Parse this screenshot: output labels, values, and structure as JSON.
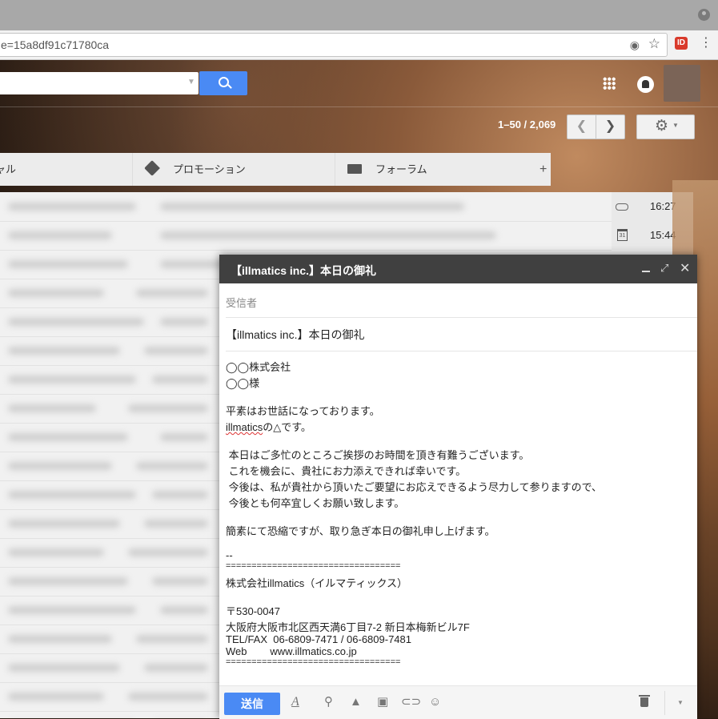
{
  "browser": {
    "url": "e=15a8df91c71780ca",
    "extension_label": "ID"
  },
  "gmail": {
    "page_count": "1–50 / 2,069",
    "tabs": [
      {
        "label": "ャル",
        "icon": "people-icon"
      },
      {
        "label": "プロモーション",
        "icon": "tag-icon"
      },
      {
        "label": "フォーラム",
        "icon": "forum-icon"
      }
    ],
    "tab_add": "+",
    "visible_rows": [
      {
        "icon": "paperclip-icon",
        "time": "16:27"
      },
      {
        "icon": "calendar-icon",
        "icon_text": "31",
        "time": "15:44"
      }
    ]
  },
  "compose": {
    "title": "【illmatics inc.】本日の御礼",
    "to_placeholder": "受信者",
    "subject": "【illmatics inc.】本日の御礼",
    "body": {
      "l1": "◯◯株式会社",
      "l2": "◯◯様",
      "l3": "平素はお世話になっております。",
      "l4a": "illmatics",
      "l4b": "の△です。",
      "l5": " 本日はご多忙のところご挨拶のお時間を頂き有難うございます。",
      "l6": " これを機会に、貴社にお力添えできれば幸いです。",
      "l7": " 今後は、私が貴社から頂いたご要望にお応えできるよう尽力して参りますので、",
      "l8": " 今後とも何卒宜しくお願い致します。",
      "l9": "簡素にて恐縮ですが、取り急ぎ本日の御礼申し上げます。",
      "l10": "--",
      "l11": "==================================",
      "l12": "株式会社illmatics（イルマティックス）",
      "l13": "〒530-0047",
      "l14": "大阪府大阪市北区西天満6丁目7-2 新日本梅新ビル7F",
      "l15": "TEL/FAX  06-6809-7471 / 06-6809-7481",
      "l16": "Web        www.illmatics.co.jp",
      "l17": "=================================="
    },
    "send_label": "送信"
  },
  "colors": {
    "accent": "#4a8af4",
    "compose_header": "#404040"
  }
}
